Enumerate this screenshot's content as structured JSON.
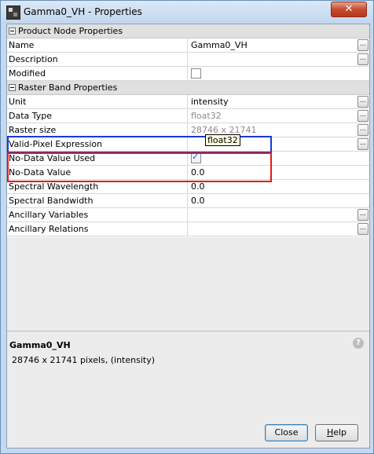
{
  "window": {
    "title": "Gamma0_VH - Properties",
    "close_glyph": "✕",
    "icon": "app-icon"
  },
  "sections": [
    {
      "title": "Product Node Properties",
      "rows": [
        {
          "label": "Name",
          "value": "Gamma0_VH",
          "kind": "text",
          "has_button": true
        },
        {
          "label": "Description",
          "value": "",
          "kind": "text",
          "has_button": true
        },
        {
          "label": "Modified",
          "value": "",
          "kind": "checkbox",
          "checked": false,
          "has_button": false
        }
      ]
    },
    {
      "title": "Raster Band Properties",
      "rows": [
        {
          "label": "Unit",
          "value": "intensity",
          "kind": "text",
          "has_button": true
        },
        {
          "label": "Data Type",
          "value": "float32",
          "kind": "text-readonly",
          "has_button": true
        },
        {
          "label": "Raster size",
          "value": "28746 x 21741",
          "kind": "text-readonly",
          "has_button": true
        },
        {
          "label": "Valid-Pixel Expression",
          "value": "",
          "kind": "text",
          "has_button": true
        },
        {
          "label": "No-Data Value Used",
          "value": "",
          "kind": "checkbox",
          "checked": true,
          "has_button": false
        },
        {
          "label": "No-Data Value",
          "value": "0.0",
          "kind": "text",
          "has_button": false
        },
        {
          "label": "Spectral Wavelength",
          "value": "0.0",
          "kind": "text",
          "has_button": false
        },
        {
          "label": "Spectral Bandwidth",
          "value": "0.0",
          "kind": "text",
          "has_button": false
        },
        {
          "label": "Ancillary Variables",
          "value": "",
          "kind": "text",
          "has_button": true
        },
        {
          "label": "Ancillary Relations",
          "value": "",
          "kind": "text",
          "has_button": true
        }
      ]
    }
  ],
  "tooltip": "float32",
  "ellipsis_label": "...",
  "checkmark": "✓",
  "description": {
    "title": "Gamma0_VH",
    "text": "28746 x 21741 pixels, (intensity)",
    "help_glyph": "?"
  },
  "buttons": {
    "close": "Close",
    "help_mnemonic": "H",
    "help_rest": "elp"
  },
  "colors": {
    "highlight_blue": "#1a3ad6",
    "highlight_red": "#e01a1a"
  }
}
